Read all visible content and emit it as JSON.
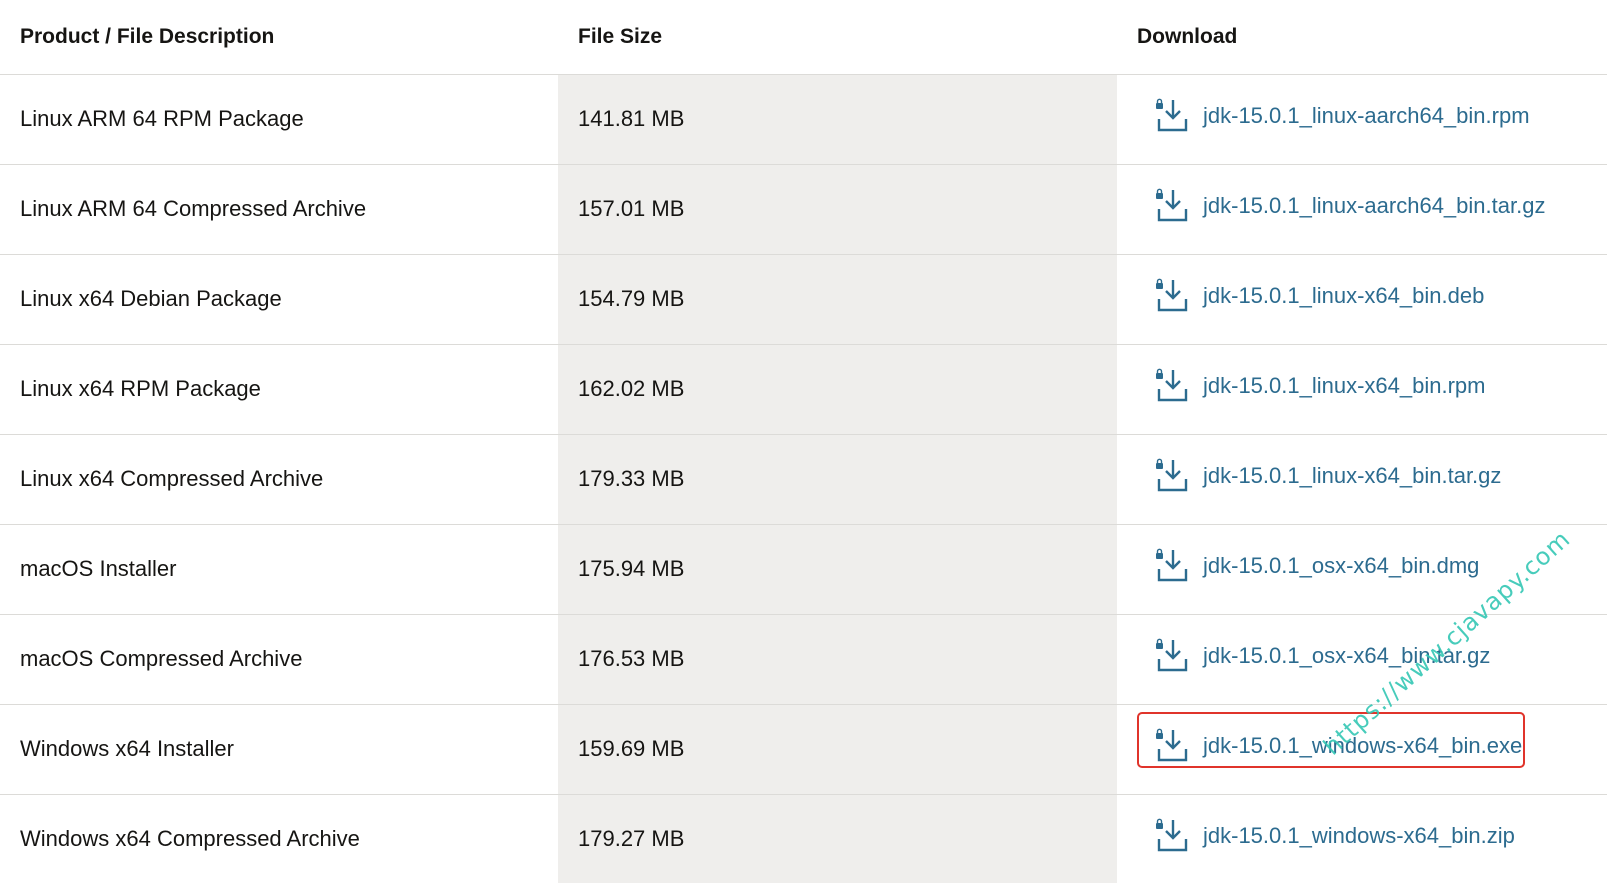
{
  "table": {
    "headers": {
      "description": "Product / File Description",
      "size": "File Size",
      "download": "Download"
    },
    "rows": [
      {
        "description": "Linux ARM 64 RPM Package",
        "size": "141.81 MB",
        "file": "jdk-15.0.1_linux-aarch64_bin.rpm"
      },
      {
        "description": "Linux ARM 64 Compressed Archive",
        "size": "157.01 MB",
        "file": "jdk-15.0.1_linux-aarch64_bin.tar.gz"
      },
      {
        "description": "Linux x64 Debian Package",
        "size": "154.79 MB",
        "file": "jdk-15.0.1_linux-x64_bin.deb"
      },
      {
        "description": "Linux x64 RPM Package",
        "size": "162.02 MB",
        "file": "jdk-15.0.1_linux-x64_bin.rpm"
      },
      {
        "description": "Linux x64 Compressed Archive",
        "size": "179.33 MB",
        "file": "jdk-15.0.1_linux-x64_bin.tar.gz"
      },
      {
        "description": "macOS Installer",
        "size": "175.94 MB",
        "file": "jdk-15.0.1_osx-x64_bin.dmg"
      },
      {
        "description": "macOS Compressed Archive",
        "size": "176.53 MB",
        "file": "jdk-15.0.1_osx-x64_bin.tar.gz"
      },
      {
        "description": "Windows x64 Installer",
        "size": "159.69 MB",
        "file": "jdk-15.0.1_windows-x64_bin.exe"
      },
      {
        "description": "Windows x64 Compressed Archive",
        "size": "179.27 MB",
        "file": "jdk-15.0.1_windows-x64_bin.zip"
      }
    ]
  },
  "watermark": "https://www.cjavapy.com",
  "icon": "lock-download-icon",
  "colors": {
    "link": "#2c6b8f",
    "size_column_bg": "#efeeec",
    "highlight": "#e0342b",
    "watermark": "#34c7b4"
  }
}
